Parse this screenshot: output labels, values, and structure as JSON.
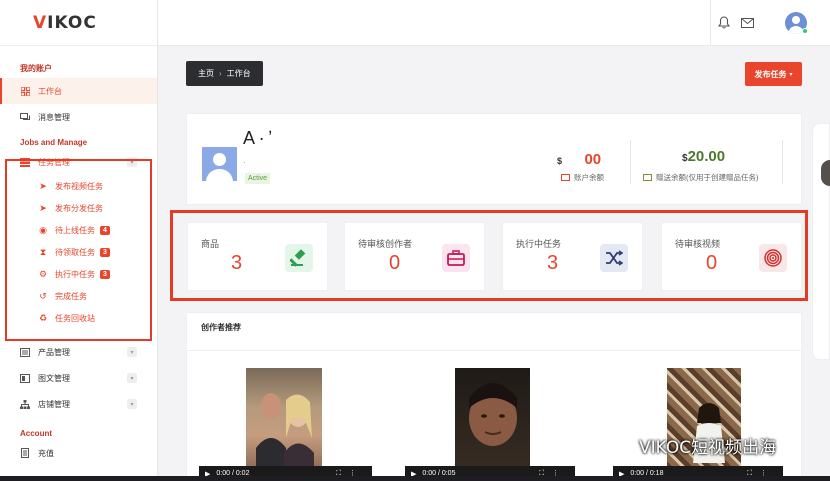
{
  "logo": {
    "text": "VIKOC",
    "first_letter": "V",
    "rest": "IKOC"
  },
  "sidebar": {
    "sections": [
      {
        "title": "我的账户"
      },
      {
        "title": "Jobs and Manage"
      },
      {
        "title": "Account"
      }
    ],
    "items": {
      "workbench": "工作台",
      "messages": "消息管理",
      "task_mgmt": "任务管理",
      "product_mgmt": "产品管理",
      "article_mgmt": "图文管理",
      "shop_mgmt": "店铺管理",
      "recharge": "充值"
    },
    "sub_items": [
      {
        "label": "发布视频任务",
        "badge": ""
      },
      {
        "label": "发布分发任务",
        "badge": ""
      },
      {
        "label": "待上线任务",
        "badge": "4"
      },
      {
        "label": "待领取任务",
        "badge": "3"
      },
      {
        "label": "执行中任务",
        "badge": "3"
      },
      {
        "label": "完成任务",
        "badge": ""
      },
      {
        "label": "任务回收站",
        "badge": ""
      }
    ]
  },
  "breadcrumb": {
    "home": "主页",
    "sep": "›",
    "current": "工作台"
  },
  "publish_button": "发布任务",
  "profile": {
    "name": "A · ʼ",
    "info": "·",
    "status": "Active"
  },
  "balances": {
    "account": {
      "prefix": "$",
      "value": "00",
      "label": "账户余额"
    },
    "gift": {
      "prefix": "$",
      "value": "20.00",
      "label": "赠送余额(仅用于创建赠品任务)"
    }
  },
  "stats": [
    {
      "label": "商品",
      "value": "3",
      "icon": "gavel-icon",
      "color": "#2e9e4f",
      "bg": "#e4f5e9"
    },
    {
      "label": "待审核创作者",
      "value": "0",
      "icon": "briefcase-icon",
      "color": "#c2185b",
      "bg": "#fbe4ee"
    },
    {
      "label": "执行中任务",
      "value": "3",
      "icon": "shuffle-icon",
      "color": "#2c3e74",
      "bg": "#e4e8f3"
    },
    {
      "label": "待审核视频",
      "value": "0",
      "icon": "target-icon",
      "color": "#d32f2f",
      "bg": "#f8e7e7"
    }
  ],
  "creators": {
    "title": "创作者推荐",
    "videos": [
      {
        "time": "0:00 / 0:02"
      },
      {
        "time": "0:00 / 0:05"
      },
      {
        "time": "0:00 / 0:18"
      }
    ]
  },
  "watermark": "VIKOC短视频出海",
  "colors": {
    "accent": "#e8452c",
    "highlight_box": "#e53a24",
    "active_green": "#5a9a3c"
  }
}
